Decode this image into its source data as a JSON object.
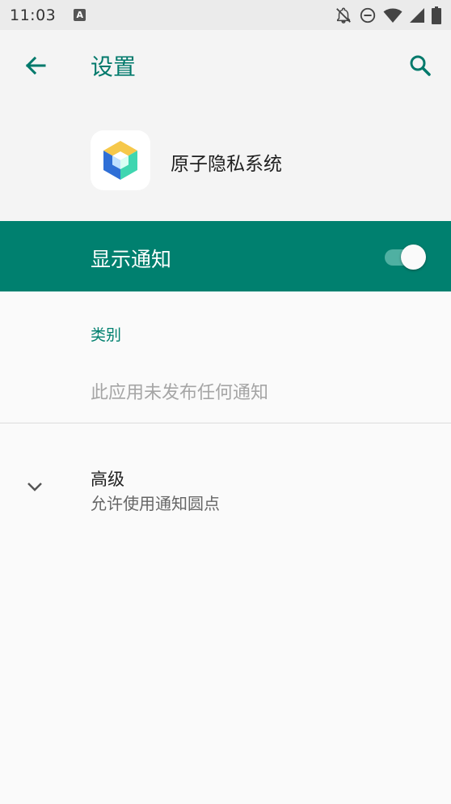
{
  "status_bar": {
    "time": "11:03",
    "notification_icon_letter": "A",
    "icons": [
      "notifications-off-icon",
      "do-not-disturb-icon",
      "wifi-icon",
      "cellular-signal-icon",
      "battery-icon"
    ]
  },
  "app_bar": {
    "title": "设置",
    "back_icon": "arrow-back-icon",
    "search_icon": "search-icon",
    "accent_color": "#00796b"
  },
  "app": {
    "name": "原子隐私系统"
  },
  "master_switch": {
    "label": "显示通知",
    "enabled": true,
    "background_color": "#00806f"
  },
  "categories": {
    "header": "类别",
    "empty_text": "此应用未发布任何通知"
  },
  "advanced": {
    "title": "高级",
    "summary": "允许使用通知圆点",
    "icon": "chevron-down-icon"
  }
}
